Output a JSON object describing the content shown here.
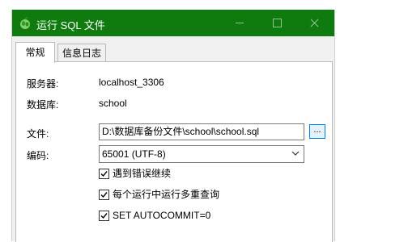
{
  "window": {
    "title": "运行 SQL 文件",
    "accent_color": "#0f7b0f",
    "app_icon": "navicat-leaf-icon",
    "controls": [
      "minimize-icon",
      "maximize-icon",
      "close-icon"
    ]
  },
  "tabs": [
    {
      "label": "常规",
      "active": true
    },
    {
      "label": "信息日志",
      "active": false
    }
  ],
  "form": {
    "server_label": "服务器:",
    "server_value": "localhost_3306",
    "database_label": "数据库:",
    "database_value": "school",
    "file_label": "文件:",
    "file_value": "D:\\数据库备份文件\\school\\school.sql",
    "browse_label": "...",
    "encoding_label": "编码:",
    "encoding_value": "65001 (UTF-8)"
  },
  "options": [
    {
      "label": "遇到错误继续",
      "checked": true
    },
    {
      "label": "每个运行中运行多重查询",
      "checked": true
    },
    {
      "label": "SET AUTOCOMMIT=0",
      "checked": true
    }
  ]
}
